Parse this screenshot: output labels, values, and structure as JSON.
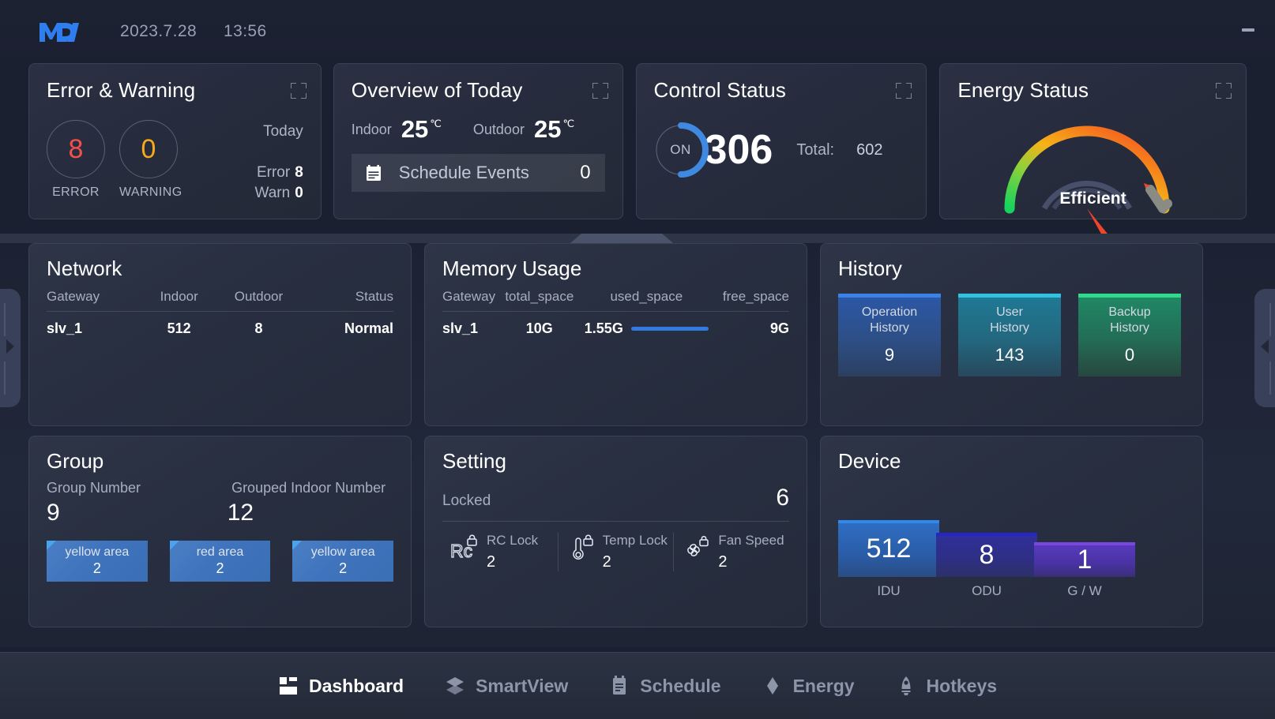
{
  "header": {
    "logo": "MDV",
    "date": "2023.7.28",
    "time": "13:56",
    "minimize_icon": "minimize-icon"
  },
  "top_cards": {
    "error_warning": {
      "title": "Error & Warning",
      "expand_icon": "expand-icon",
      "error_value": "8",
      "error_label": "ERROR",
      "warning_value": "0",
      "warning_label": "WARNING",
      "today_label": "Today",
      "error_stat_label": "Error",
      "error_stat_value": "8",
      "warn_stat_label": "Warn",
      "warn_stat_value": "0",
      "error_color": "#f2504d",
      "warning_color": "#f9a81a"
    },
    "overview": {
      "title": "Overview of Today",
      "expand_icon": "expand-icon",
      "indoor_label": "Indoor",
      "indoor_value": "25",
      "indoor_unit": "℃",
      "outdoor_label": "Outdoor",
      "outdoor_value": "25",
      "outdoor_unit": "℃",
      "schedule_icon": "calendar-icon",
      "schedule_label": "Schedule Events",
      "schedule_count": "0"
    },
    "control_status": {
      "title": "Control Status",
      "expand_icon": "expand-icon",
      "on_label": "ON",
      "on_value": "306",
      "total_label": "Total:",
      "total_value": "602",
      "arc_color": "#3f8ae0",
      "arc_percent": 51
    },
    "energy_status": {
      "title": "Energy Status",
      "expand_icon": "expand-icon",
      "gauge_label": "Efficient",
      "needle_angle_deg": 56,
      "gradient_start": "#16d35e",
      "gradient_mid": "#f5b318",
      "gradient_end": "#f0452a"
    }
  },
  "main": {
    "network": {
      "title": "Network",
      "columns": [
        "Gateway",
        "Indoor",
        "Outdoor",
        "Status"
      ],
      "rows": [
        [
          "slv_1",
          "512",
          "8",
          "Normal"
        ]
      ]
    },
    "memory": {
      "title": "Memory Usage",
      "columns": [
        "Gateway",
        "total_space",
        "used_space",
        "free_space"
      ],
      "gateway": "slv_1",
      "total_space": "10G",
      "used_space": "1.55G",
      "free_space": "9G",
      "bar_color": "#3279e0"
    },
    "history": {
      "title": "History",
      "tiles": [
        {
          "name": "Operation\nHistory",
          "line1": "Operation",
          "line2": "History",
          "value": "9"
        },
        {
          "name": "User History",
          "line1": "User",
          "line2": "History",
          "value": "143"
        },
        {
          "name": "Backup History",
          "line1": "Backup",
          "line2": "History",
          "value": "0"
        }
      ]
    },
    "group": {
      "title": "Group",
      "group_number_label": "Group Number",
      "group_number_value": "9",
      "grouped_indoor_label": "Grouped Indoor Number",
      "grouped_indoor_value": "12",
      "areas": [
        {
          "name": "yellow area",
          "value": "2"
        },
        {
          "name": "red area",
          "value": "2"
        },
        {
          "name": "yellow area",
          "value": "2"
        }
      ]
    },
    "setting": {
      "title": "Setting",
      "locked_label": "Locked",
      "locked_value": "6",
      "items": [
        {
          "icon": "rc-lock-icon",
          "name": "RC Lock",
          "value": "2"
        },
        {
          "icon": "temp-lock-icon",
          "name": "Temp Lock",
          "value": "2"
        },
        {
          "icon": "fan-speed-lock-icon",
          "name": "Fan Speed",
          "value": "2"
        }
      ]
    },
    "device": {
      "title": "Device",
      "bars": [
        {
          "value": "512",
          "label": "IDU"
        },
        {
          "value": "8",
          "label": "ODU"
        },
        {
          "value": "1",
          "label": "G / W"
        }
      ]
    }
  },
  "bottom_nav": {
    "items": [
      {
        "label": "Dashboard",
        "icon": "dashboard-icon",
        "active": true
      },
      {
        "label": "SmartView",
        "icon": "layers-icon",
        "active": false
      },
      {
        "label": "Schedule",
        "icon": "calendar-icon",
        "active": false
      },
      {
        "label": "Energy",
        "icon": "energy-drop-icon",
        "active": false
      },
      {
        "label": "Hotkeys",
        "icon": "rocket-icon",
        "active": false
      }
    ]
  },
  "side_handles": {
    "left_icon": "chevron-right-icon",
    "right_icon": "chevron-left-icon"
  }
}
